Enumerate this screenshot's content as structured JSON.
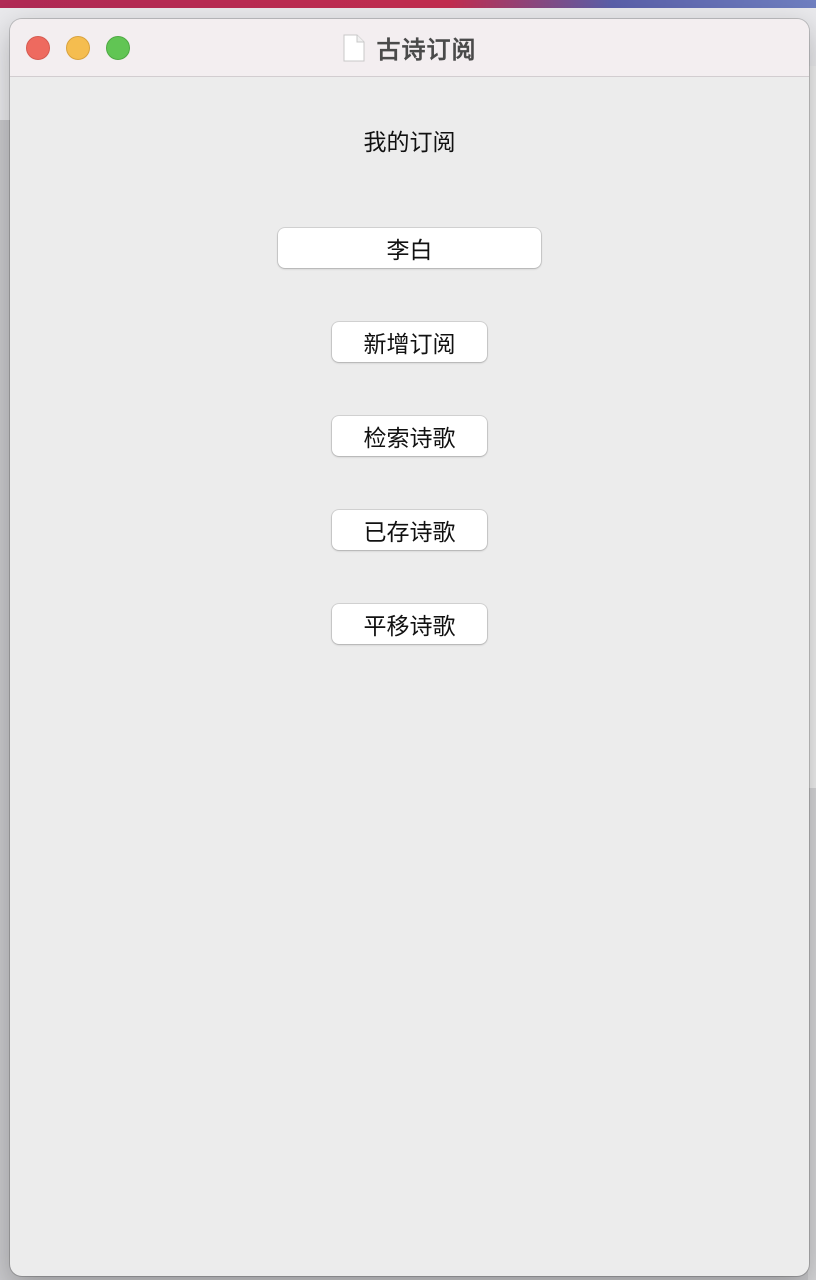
{
  "window": {
    "title": "古诗订阅",
    "title_icon": "document-icon",
    "controls": [
      "close",
      "minimize",
      "zoom"
    ]
  },
  "main": {
    "heading": "我的订阅",
    "subscriptions": [
      "李白"
    ],
    "actions": {
      "new_subscription": "新增订阅",
      "search_poems": "检索诗歌",
      "saved_poems": "已存诗歌",
      "shift_poems": "平移诗歌"
    }
  },
  "colors": {
    "close": "#ee6a5f",
    "minimize": "#f5bd4f",
    "zoom": "#61c554",
    "window_bg": "#ececec",
    "titlebar_bg": "#f3eef0"
  }
}
